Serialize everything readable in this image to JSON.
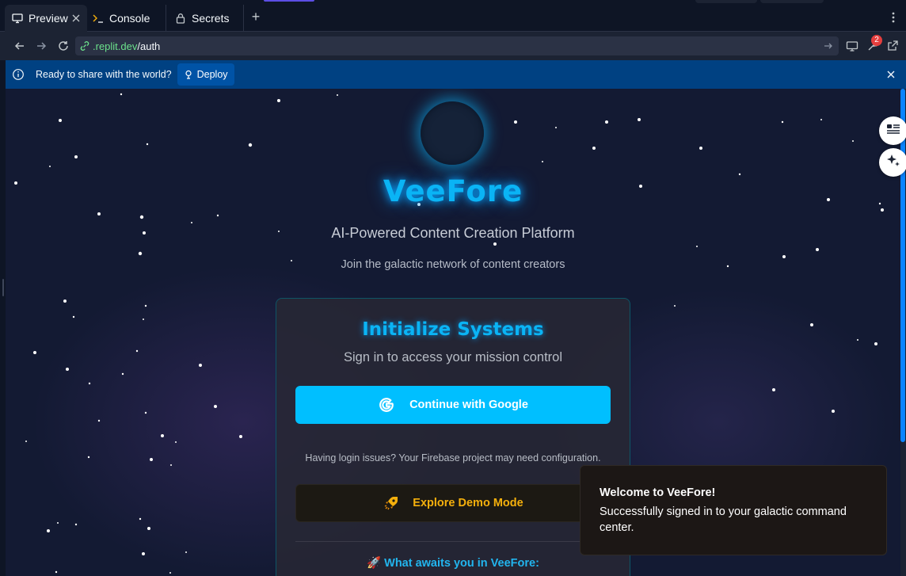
{
  "tabs": [
    {
      "label": "Preview",
      "icon": "monitor-icon",
      "active": true
    },
    {
      "label": "Console",
      "icon": "terminal-icon",
      "active": false
    },
    {
      "label": "Secrets",
      "icon": "lock-icon",
      "active": false
    }
  ],
  "url": {
    "domain": ".replit.dev",
    "path": "/auth"
  },
  "notifications_count": "2",
  "banner": {
    "text": "Ready to share with the world?",
    "deploy_label": "Deploy"
  },
  "app": {
    "brand": "VeeFore",
    "tagline": "AI-Powered Content Creation Platform",
    "subtagline": "Join the galactic network of content creators",
    "card": {
      "title": "Initialize Systems",
      "subtitle": "Sign in to access your mission control",
      "google_button": "Continue with Google",
      "help_text": "Having login issues? Your Firebase project may need configuration.",
      "demo_button": "Explore Demo Mode",
      "awaits": "🚀 What awaits you in VeeFore:"
    }
  },
  "toast": {
    "title": "Welcome to VeeFore!",
    "body": "Successfully signed in to your galactic command center."
  },
  "colors": {
    "accent": "#0ab4f5",
    "google_button": "#00bfff",
    "demo_text": "#f5b00c",
    "banner": "#004182"
  }
}
